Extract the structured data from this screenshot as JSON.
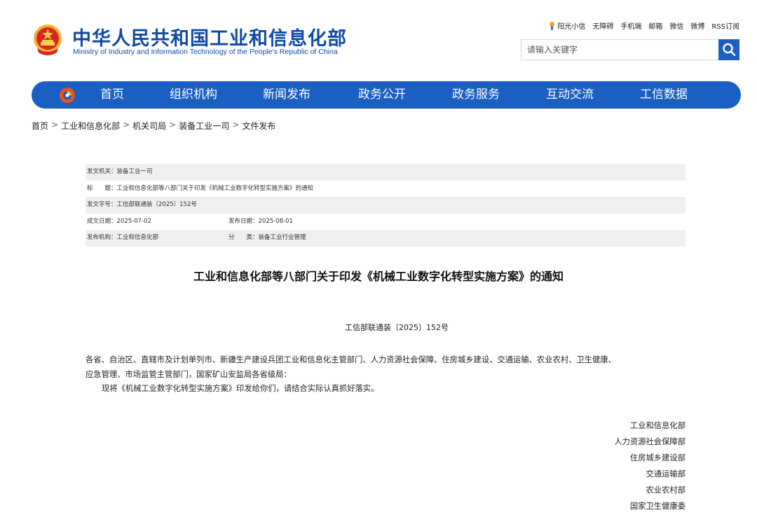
{
  "header": {
    "site_title": "中华人民共和国工业和信息化部",
    "site_subtitle": "Ministry of Industry and Information Technology of the People's Republic of China",
    "toplinks": [
      "阳光小信",
      "无障碍",
      "手机端",
      "邮箱",
      "微信",
      "微博",
      "RSS订阅"
    ],
    "search_placeholder": "请输入关键字"
  },
  "nav": {
    "items": [
      "首页",
      "组织机构",
      "新闻发布",
      "政务公开",
      "政务服务",
      "互动交流",
      "工信数据"
    ]
  },
  "breadcrumb": [
    "首页",
    "工业和信息化部",
    "机关司局",
    "装备工业一司",
    "文件发布"
  ],
  "meta": {
    "issuer_label": "发文机关：",
    "issuer": "装备工业一司",
    "title_label": "标　　题：",
    "title": "工业和信息化部等八部门关于印发《机械工业数字化转型实施方案》的通知",
    "doc_no_label": "发文字号：",
    "doc_no": "工信部联通装〔2025〕152号",
    "created_label": "成文日期：",
    "created": "2025-07-02",
    "published_label": "发布日期：",
    "published": "2025-08-01",
    "org_label": "发布机构：",
    "org": "工业和信息化部",
    "category_label": "分　　类：",
    "category": "装备工业行业管理"
  },
  "article": {
    "title": "工业和信息化部等八部门关于印发《机械工业数字化转型实施方案》的通知",
    "doc_no": "工信部联通装〔2025〕152号",
    "addressee_line1": "各省、自治区、直辖市及计划单列市、新疆生产建设兵团工业和信息化主管部门、人力资源社会保障、住房城乡建设、交通运输、农业农村、卫生健康、",
    "addressee_line2": "应急管理、市场监管主管部门，国家矿山安监局各省级局：",
    "body": "现将《机械工业数字化转型实施方案》印发给你们，请结合实际认真抓好落实。",
    "signers": [
      "工业和信息化部",
      "人力资源社会保障部",
      "住房城乡建设部",
      "交通运输部",
      "农业农村部",
      "国家卫生健康委"
    ]
  },
  "colors": {
    "brand_blue": "#1a5fc2",
    "title_blue": "#0f4aa6",
    "meta_shade": "#efefef"
  }
}
